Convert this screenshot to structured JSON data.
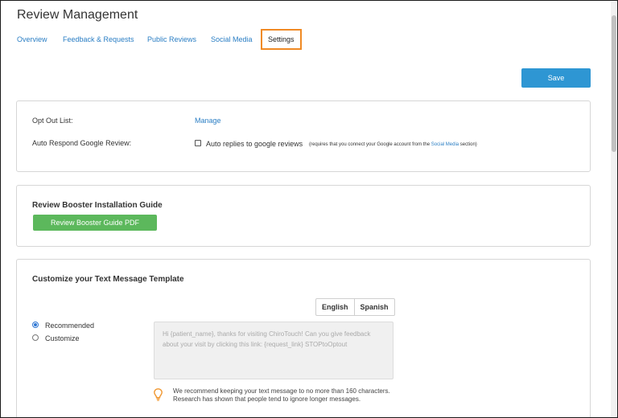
{
  "app": {
    "title": "Review Management"
  },
  "tabs": [
    {
      "label": "Overview",
      "active": false
    },
    {
      "label": "Feedback & Requests",
      "active": false
    },
    {
      "label": "Public Reviews",
      "active": false
    },
    {
      "label": "Social Media",
      "active": false
    },
    {
      "label": "Settings",
      "active": true
    }
  ],
  "toolbar": {
    "save_label": "Save"
  },
  "settings": {
    "opt_out_label": "Opt Out List:",
    "opt_out_link": "Manage",
    "auto_respond_label": "Auto Respond Google Review:",
    "auto_reply_checkbox_label": "Auto replies to google reviews",
    "auto_reply_checked": false,
    "auto_reply_note_before": "(requires that you connect your Google account from the",
    "auto_reply_note_link": "Social Media",
    "auto_reply_note_after": "section)"
  },
  "booster": {
    "title": "Review Booster Installation Guide",
    "button_label": "Review Booster Guide PDF"
  },
  "template": {
    "title": "Customize your Text Message Template",
    "languages": [
      "English",
      "Spanish"
    ],
    "options": [
      {
        "label": "Recommended",
        "checked": true
      },
      {
        "label": "Customize",
        "checked": false
      }
    ],
    "message": "Hi {patient_name}, thanks for visiting ChiroTouch! Can you give feedback about your visit by clicking this link: {request_link} STOPtoOptout",
    "hint_line1": "We recommend keeping your text message to no more than 160 characters.",
    "hint_line2": "Research has shown that people tend to ignore longer messages."
  },
  "colors": {
    "accent": "#2e96d3",
    "link": "#2a7ec4",
    "active_tab_border": "#f08a24",
    "green_button": "#5cb85c",
    "bulb": "#f0962e"
  },
  "icons": {
    "hint": "lightbulb-icon"
  }
}
